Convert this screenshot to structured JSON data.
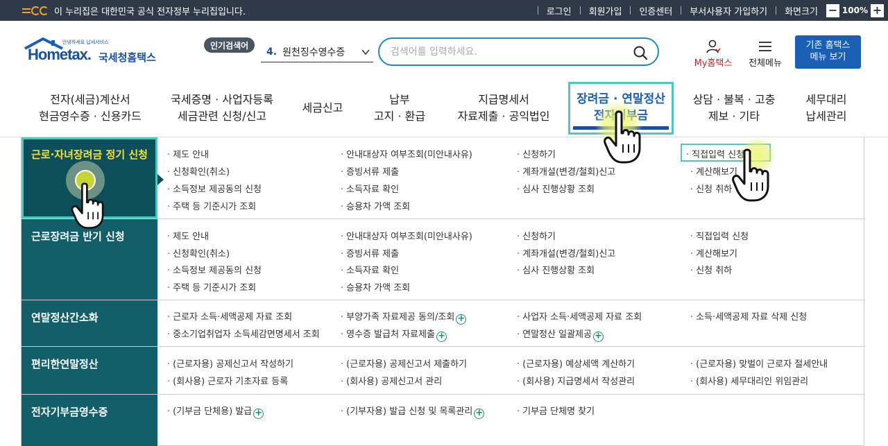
{
  "topbar": {
    "gov_notice": "이 누리집은 대한민국 공식 전자정부 누리집입니다.",
    "links": [
      "로그인",
      "회원가입",
      "인증센터",
      "부서사용자 가입하기",
      "화면크기"
    ],
    "zoom_minus": "−",
    "zoom_level": "100%",
    "zoom_plus": "+"
  },
  "header": {
    "logo_tagline": "안녕하세요 납세서비스",
    "logo_text": "Hometax.",
    "logo_org": "국세청홈택스",
    "popular_badge": "인기검색어",
    "popular_rank": "4.",
    "popular_term": "원천징수영수증",
    "search_placeholder": "검색어를 입력하세요.",
    "my_hometax": "My홈택스",
    "all_menu": "전체메뉴",
    "old_home_line1": "기존 홈택스",
    "old_home_line2": "메뉴 보기"
  },
  "nav": {
    "items": [
      {
        "line1": "전자(세금)계산서",
        "line2": "현금영수증 · 신용카드"
      },
      {
        "line1": "국세증명 · 사업자등록",
        "line2": "세금관련 신청/신고"
      },
      {
        "line1": "세금신고",
        "line2": ""
      },
      {
        "line1": "납부",
        "line2": "고지 · 환급"
      },
      {
        "line1": "지급명세서",
        "line2": "자료제출 · 공익법인"
      },
      {
        "line1": "장려금 · 연말정산",
        "line2": "전자기부금"
      },
      {
        "line1": "상담 · 불복 · 고충",
        "line2": "제보 · 기타"
      },
      {
        "line1": "세무대리",
        "line2": "납세관리"
      }
    ]
  },
  "mega": {
    "rows": [
      {
        "category": "근로·자녀장려금 정기 신청",
        "cols": [
          [
            "제도 안내",
            "신청확인(취소)",
            "소득정보 제공동의 신청",
            "주택 등 기준시가 조회"
          ],
          [
            "안내대상자 여부조회(미안내사유)",
            "증빙서류 제출",
            "소득자료 확인",
            "승용차 가액 조회"
          ],
          [
            "신청하기",
            "계좌개설(변경/철회)신고",
            "심사 진행상황 조회"
          ],
          [
            "직접입력 신청",
            "계산해보기",
            "신청 취하"
          ]
        ]
      },
      {
        "category": "근로장려금 반기 신청",
        "cols": [
          [
            "제도 안내",
            "신청확인(취소)",
            "소득정보 제공동의 신청",
            "주택 등 기준시가 조회"
          ],
          [
            "안내대상자 여부조회(미안내사유)",
            "증빙서류 제출",
            "소득자료 확인",
            "승용차 가액 조회"
          ],
          [
            "신청하기",
            "계좌개설(변경/철회)신고",
            "심사 진행상황 조회"
          ],
          [
            "직접입력 신청",
            "계산해보기",
            "신청 취하"
          ]
        ]
      },
      {
        "category": "연말정산간소화",
        "cols": [
          [
            "근로자 소득·세액공제 자료 조회",
            "중소기업취업자 소득세감면명세서 조회"
          ],
          [
            "부양가족 자료제공 동의/조회",
            "영수증 발급처 자료제출"
          ],
          [
            "사업자 소득·세액공제 자료 조회",
            "연말정산 일괄제공"
          ],
          [
            "소득·세액공제 자료 삭제 신청"
          ]
        ]
      },
      {
        "category": "편리한연말정산",
        "cols": [
          [
            "(근로자용) 공제신고서 작성하기",
            "(회사용) 근로자 기초자료 등록"
          ],
          [
            "(근로자용) 공제신고서 제출하기",
            "(회사용) 공제신고서 관리"
          ],
          [
            "(근로자용) 예상세액 계산하기",
            "(회사용) 지급명세서 작성관리"
          ],
          [
            "(근로자용) 맞벌이 근로자 절세안내",
            "(회사용) 세무대리인 위임관리"
          ]
        ]
      },
      {
        "category": "전자기부금영수증",
        "cols": [
          [
            "(기부금 단체용) 발급"
          ],
          [
            "(기부자용) 발급 신청 및 목록관리"
          ],
          [
            "기부금 단체명 찾기"
          ],
          []
        ]
      }
    ]
  },
  "colors": {
    "topbar_bg": "#2f3a48",
    "brand_blue": "#1a5fb4",
    "sidebar_teal": "#125f6a",
    "highlight_cyan": "#4fc6c1",
    "active_category_text": "#f7e33c",
    "my_hometax_red": "#c4262e"
  },
  "icons": [
    "government-logo-icon",
    "zoom-minus-icon",
    "zoom-plus-icon",
    "house-roof-logo-icon",
    "chevron-down-icon",
    "search-icon",
    "user-icon",
    "hamburger-menu-icon",
    "plus-circle-icon",
    "pointer-hand-icon"
  ]
}
